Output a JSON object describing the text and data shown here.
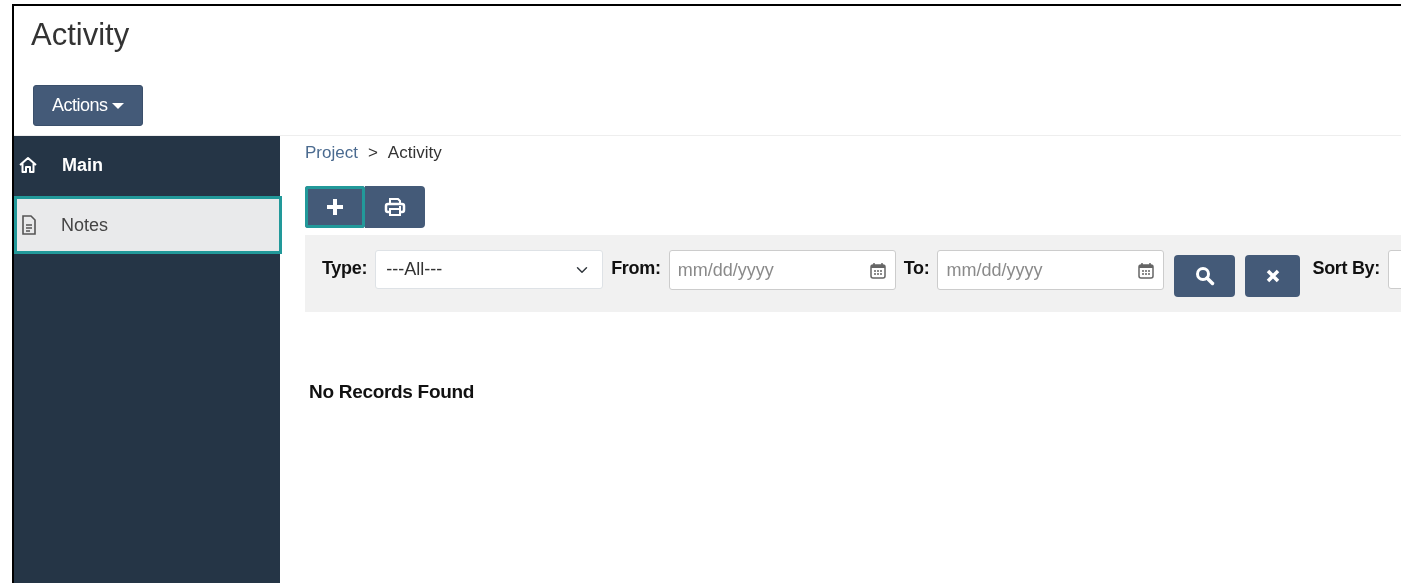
{
  "page_title": "Activity",
  "actions_button": {
    "label": "Actions"
  },
  "sidebar": {
    "items": [
      {
        "kind": "home",
        "label": "Main",
        "selected": false
      },
      {
        "kind": "document",
        "label": "Notes",
        "selected": true
      }
    ]
  },
  "breadcrumb": [
    {
      "label": "Project",
      "link": true
    },
    {
      "label": "Activity",
      "link": false
    }
  ],
  "breadcrumb_separator": ">",
  "toolbar": [
    {
      "kind": "add",
      "highlighted": true
    },
    {
      "kind": "print",
      "highlighted": false
    }
  ],
  "filters": {
    "type": {
      "label": "Type:",
      "value": "---All---"
    },
    "from": {
      "label": "From:",
      "placeholder": "mm/dd/yyyy"
    },
    "to": {
      "label": "To:",
      "placeholder": "mm/dd/yyyy"
    },
    "sort_by": {
      "label": "Sort By:"
    }
  },
  "filter_buttons": [
    {
      "kind": "search"
    },
    {
      "kind": "clear"
    }
  ],
  "empty_message": "No Records Found"
}
